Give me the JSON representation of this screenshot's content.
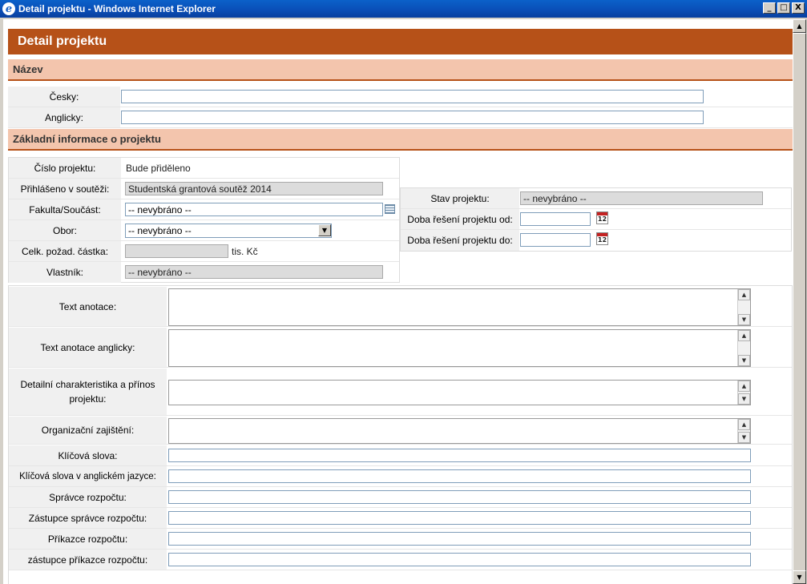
{
  "window": {
    "title": "Detail projektu - Windows Internet Explorer",
    "minimize": "_",
    "maximize": "□",
    "close": "X"
  },
  "header": {
    "title": "Detail projektu"
  },
  "sections": {
    "nazev": "Název",
    "zakladni": "Základní informace o projektu"
  },
  "nazev": {
    "cesky_label": "Česky:",
    "cesky_value": "",
    "anglicky_label": "Anglicky:",
    "anglicky_value": ""
  },
  "info": {
    "cislo_label": "Číslo projektu:",
    "cislo_value": "Bude přiděleno",
    "prihlaseno_label": "Přihlášeno v soutěži:",
    "prihlaseno_value": "Studentská grantová soutěž 2014",
    "fakulta_label": "Fakulta/Součást:",
    "fakulta_value": "-- nevybráno --",
    "obor_label": "Obor:",
    "obor_value": "-- nevybráno --",
    "castka_label": "Celk. požad. částka:",
    "castka_value": "",
    "castka_unit": "tis. Kč",
    "vlastnik_label": "Vlastník:",
    "vlastnik_value": "-- nevybráno --",
    "stav_label": "Stav projektu:",
    "stav_value": "-- nevybráno --",
    "od_label": "Doba řešení projektu od:",
    "od_value": "",
    "do_label": "Doba řešení projektu do:",
    "do_value": "",
    "calendar_day": "12"
  },
  "details": {
    "anotace_label": "Text anotace:",
    "anotace_en_label": "Text anotace anglicky:",
    "charakteristika_label": "Detailní charakteristika a přínos projektu:",
    "organizacni_label": "Organizační zajištění:",
    "klicova_label": "Klíčová slova:",
    "klicova_en_label": "Klíčová slova v anglickém jazyce:",
    "spravce_label": "Správce rozpočtu:",
    "zastupce_spravce_label": "Zástupce správce rozpočtu:",
    "prikazce_label": "Příkazce rozpočtu:",
    "zastupce_prikazce_label": "zástupce příkazce rozpočtu:"
  },
  "icons": {
    "app": "internet-explorer-icon",
    "list": "list-icon",
    "calendar": "calendar-icon"
  },
  "colors": {
    "accent": "#b65118",
    "section": "#f3c5ad",
    "titlebar": "#0a4fb8"
  }
}
